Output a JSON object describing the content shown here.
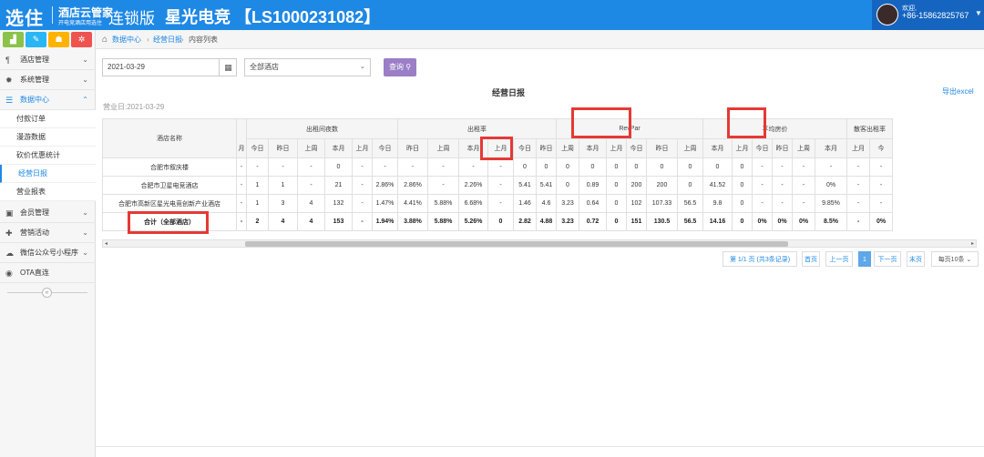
{
  "header": {
    "logo_main": "选住",
    "logo_sub1": "酒店云管家",
    "logo_sub2": "开电竞酒店用选住",
    "edition": "连锁版",
    "hotel_title": "星光电竞 【LS1000231082】",
    "user_welcome": "欢迎,",
    "user_phone": "+86-15862825767",
    "brand_color": "#1e88e5"
  },
  "sidebar": {
    "quick_buttons": [
      {
        "icon": "chart-icon",
        "glyph": "▟",
        "color": "#8bc34a"
      },
      {
        "icon": "pencil-icon",
        "glyph": "✎",
        "color": "#29b6f6"
      },
      {
        "icon": "users-icon",
        "glyph": "☗",
        "color": "#ffb300"
      },
      {
        "icon": "gears-icon",
        "glyph": "✲",
        "color": "#ef5350"
      }
    ],
    "menu": [
      {
        "label": "酒店管理",
        "icon": "cutlery-icon",
        "glyph": "¶"
      },
      {
        "label": "系统管理",
        "icon": "gear-icon",
        "glyph": "✹"
      },
      {
        "label": "数据中心",
        "icon": "database-icon",
        "glyph": "☰"
      },
      {
        "label": "会员管理",
        "icon": "card-icon",
        "glyph": "▣"
      },
      {
        "label": "营销活动",
        "icon": "gift-icon",
        "glyph": "✚"
      },
      {
        "label": "微信公众号小程序",
        "icon": "cloud-icon",
        "glyph": "☁"
      },
      {
        "label": "OTA直连",
        "icon": "eye-icon",
        "glyph": "◉"
      }
    ],
    "submenu": [
      "付款订单",
      "漫游数据",
      "砍价优惠统计",
      "经营日报",
      "营业报表"
    ]
  },
  "breadcrumb": [
    "数据中心",
    "经营日报",
    "内容列表"
  ],
  "filters": {
    "date": "2021-03-29",
    "hotel": "全部酒店",
    "query_label": "查询",
    "query_color": "#9a7fc7"
  },
  "report": {
    "title": "经营日报",
    "export_label": "导出excel",
    "biz_date": "营业日:2021-03-29",
    "name_header": "酒店名称",
    "groups": [
      {
        "label": "出租间夜数",
        "cols": 6
      },
      {
        "label": "出租率",
        "cols": 6
      },
      {
        "label": "RevPar",
        "cols": 6
      },
      {
        "label": "平均房价",
        "cols": 6
      },
      {
        "label": "散客出租率",
        "cols": 6
      }
    ],
    "subcols": [
      "月",
      "今日",
      "昨日",
      "上周",
      "本月",
      "上月",
      "今日",
      "昨日",
      "上周",
      "本月",
      "上月",
      "今日",
      "昨日",
      "上周",
      "本月",
      "上月",
      "今日",
      "昨日",
      "上周",
      "本月",
      "上月",
      "今日",
      "昨日",
      "上周",
      "本月",
      "上月",
      "今"
    ],
    "rows": [
      {
        "name": "合肥市叙庆楼",
        "cells": [
          "-",
          "-",
          "-",
          "-",
          "0",
          "-",
          "-",
          "-",
          "-",
          "-",
          "-",
          "0",
          "0",
          "0",
          "0",
          "0",
          "0",
          "0",
          "0",
          "0",
          "0",
          "-",
          "-",
          "-",
          "-",
          "-",
          "-"
        ]
      },
      {
        "name": "合肥市卫星电竞酒店",
        "cells": [
          "-",
          "1",
          "1",
          "-",
          "21",
          "-",
          "2.86%",
          "2.86%",
          "-",
          "2.26%",
          "-",
          "5.41",
          "5.41",
          "0",
          "0.89",
          "0",
          "200",
          "200",
          "0",
          "41.52",
          "0",
          "-",
          "-",
          "-",
          "0%",
          "-",
          "-"
        ]
      },
      {
        "name": "合肥市高新区星光电竞创新产业酒店",
        "cells": [
          "-",
          "1",
          "3",
          "4",
          "132",
          "-",
          "1.47%",
          "4.41%",
          "5.88%",
          "6.68%",
          "-",
          "1.46",
          "4.6",
          "3.23",
          "0.64",
          "0",
          "102",
          "107.33",
          "56.5",
          "9.8",
          "0",
          "-",
          "-",
          "-",
          "9.85%",
          "-",
          "-"
        ]
      },
      {
        "name": "合计（全部酒店）",
        "cells": [
          "-",
          "2",
          "4",
          "4",
          "153",
          "-",
          "1.94%",
          "3.88%",
          "5.88%",
          "5.26%",
          "0",
          "2.82",
          "4.88",
          "3.23",
          "0.72",
          "0",
          "151",
          "130.5",
          "56.5",
          "14.16",
          "0",
          "0%",
          "0%",
          "0%",
          "8.5%",
          "-",
          "0%"
        ]
      }
    ],
    "highlight_color": "#e53935"
  },
  "pager": {
    "info": "第 1/1 页 (共3条记录)",
    "first": "首页",
    "prev": "上一页",
    "current": "1",
    "next": "下一页",
    "last": "末页",
    "per_page": "每页10条"
  }
}
